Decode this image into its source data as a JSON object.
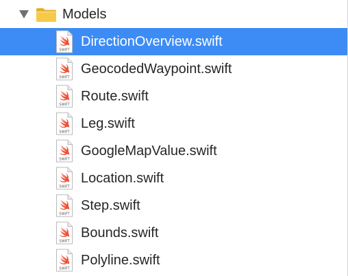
{
  "navigator": {
    "group": {
      "label": "Models",
      "expanded": true,
      "icon": "folder-icon",
      "folder_color": "#f7c948"
    },
    "files": [
      {
        "label": "DirectionOverview.swift",
        "selected": true
      },
      {
        "label": "GeocodedWaypoint.swift",
        "selected": false
      },
      {
        "label": "Route.swift",
        "selected": false
      },
      {
        "label": "Leg.swift",
        "selected": false
      },
      {
        "label": "GoogleMapValue.swift",
        "selected": false
      },
      {
        "label": "Location.swift",
        "selected": false
      },
      {
        "label": "Step.swift",
        "selected": false
      },
      {
        "label": "Bounds.swift",
        "selected": false
      },
      {
        "label": "Polyline.swift",
        "selected": false
      }
    ],
    "file_icon": "swift-file-icon",
    "file_icon_caption": "SWIFT",
    "selection_color": "#3d8cf5",
    "swift_color": "#f05138"
  }
}
